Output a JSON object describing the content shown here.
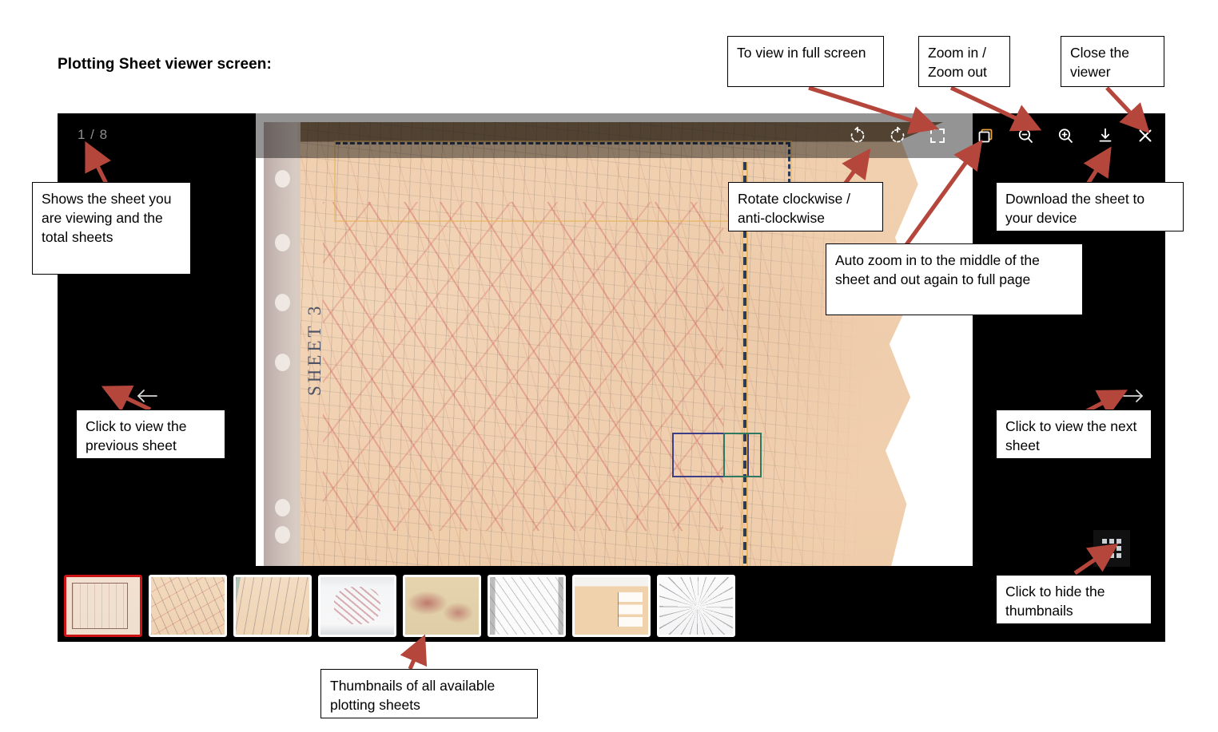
{
  "heading": "Plotting Sheet viewer screen:",
  "viewer": {
    "page_counter": "1 / 8",
    "sheet_label": "SHEET 3",
    "current_sheet": 1,
    "total_sheets": 8,
    "nav": {
      "prev_icon": "arrow-left-icon",
      "next_icon": "arrow-right-icon"
    },
    "toolbar": {
      "buttons": [
        {
          "name": "rotate-clockwise-button",
          "icon": "rotate-cw-icon"
        },
        {
          "name": "rotate-anticlockwise-button",
          "icon": "rotate-ccw-icon"
        },
        {
          "name": "full-screen-button",
          "icon": "expand-icon"
        },
        {
          "name": "auto-zoom-button",
          "icon": "copy-squares-icon"
        },
        {
          "name": "zoom-out-button",
          "icon": "magnifier-minus-icon"
        },
        {
          "name": "zoom-in-button",
          "icon": "magnifier-plus-icon"
        },
        {
          "name": "download-button",
          "icon": "download-icon"
        },
        {
          "name": "close-button",
          "icon": "close-x-icon"
        }
      ]
    },
    "grid_toggle": {
      "name": "hide-thumbnails-button",
      "icon": "grid-dots-icon"
    },
    "thumbnails": [
      {
        "index": 1,
        "selected": true
      },
      {
        "index": 2,
        "selected": false
      },
      {
        "index": 3,
        "selected": false
      },
      {
        "index": 4,
        "selected": false
      },
      {
        "index": 5,
        "selected": false
      },
      {
        "index": 6,
        "selected": false
      },
      {
        "index": 7,
        "selected": false
      },
      {
        "index": 8,
        "selected": false
      }
    ]
  },
  "callouts": {
    "full_screen": "To view in full screen",
    "zoom": "Zoom in / Zoom out",
    "close": "Close the viewer",
    "page_counter": "Shows the sheet you are viewing and the total sheets",
    "rotate": "Rotate clockwise / anti-clockwise",
    "download": "Download the sheet to your device",
    "auto_zoom": "Auto zoom in to the middle of the sheet and out again to full page",
    "prev": "Click to view the previous sheet",
    "next": "Click to view the next sheet",
    "hide_thumbnails": "Click to hide the thumbnails",
    "thumbnails": "Thumbnails of all available plotting sheets"
  },
  "colors": {
    "annotation_arrow": "#b5463c",
    "selected_thumb_border": "#cc1417",
    "viewer_background": "#000000",
    "toolbar_overlay": "rgba(0,0,0,0.42)",
    "counter_text": "#8f8f8f"
  }
}
